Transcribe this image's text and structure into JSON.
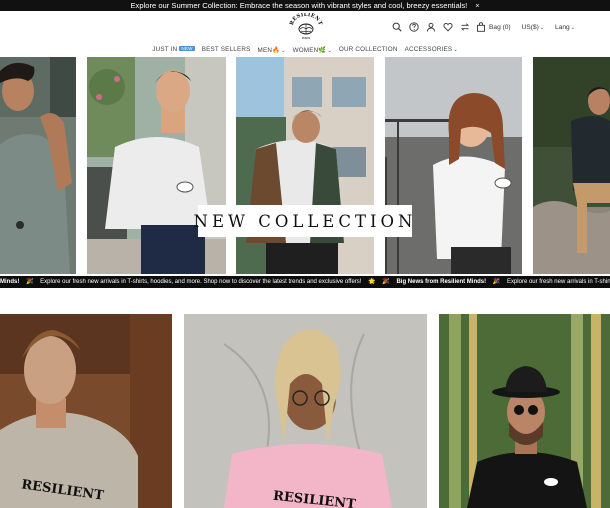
{
  "announcement": {
    "text": "Explore our Summer Collection: Embrace the season with vibrant styles and cool, breezy essentials!",
    "close_symbol": "×"
  },
  "header": {
    "logo_text": "RESILIENT",
    "logo_sub": "MINDS",
    "icons": [
      "search-icon",
      "help-icon",
      "account-icon",
      "wishlist-icon",
      "compare-icon"
    ],
    "bag_label": "Bag (0)",
    "currency": "US($)",
    "language": "Lang"
  },
  "nav": {
    "items": [
      {
        "label": "JUST IN",
        "badge": "NEW"
      },
      {
        "label": "BEST SELLERS"
      },
      {
        "label": "MEN",
        "emoji": "🔥"
      },
      {
        "label": "WOMEN",
        "emoji": "🌿"
      },
      {
        "label": "OUR COLLECTION"
      },
      {
        "label": "ACCESSORIES"
      }
    ]
  },
  "hero": {
    "title": "NEW COLLECTION"
  },
  "ticker": {
    "lead_fragment": "Minds!",
    "message": "Explore our fresh new arrivals in T-shirts, hoodies, and more. Shop now to discover the latest trends and exclusive offers!",
    "headline": "Big News from Resilient Minds!",
    "emoji_start": "🎉",
    "emoji_end": "🌟"
  },
  "tiles": {
    "shirt_print_1": "RESILIENT",
    "shirt_print_2": "RESILIENT"
  },
  "colors": {
    "announcement_bg": "#111111",
    "ticker_bg": "#0d0d0d",
    "new_badge": "#4a90d9"
  }
}
